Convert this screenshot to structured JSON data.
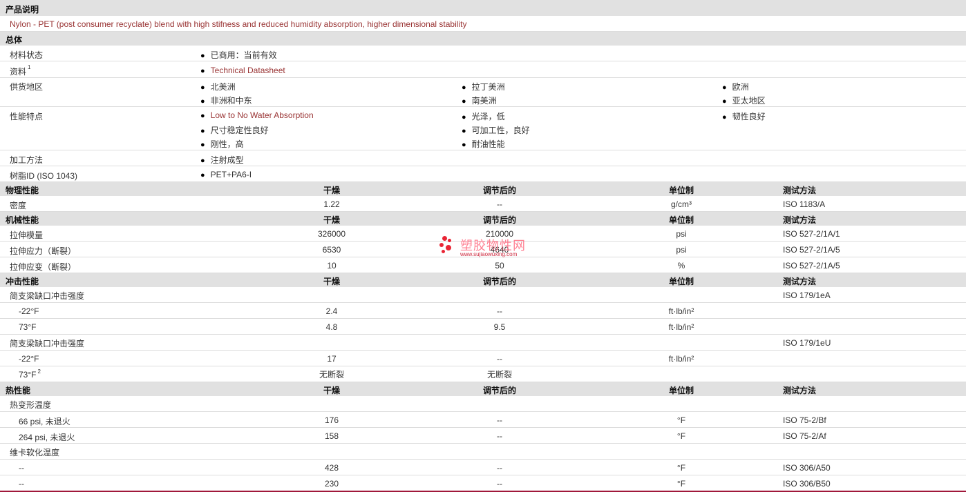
{
  "product_desc": {
    "header": "产品说明",
    "text": "Nylon - PET (post consumer recyclate) blend with high stifness and reduced humidity absorption, higher dimensional stability"
  },
  "general": {
    "header": "总体",
    "rows": {
      "status": {
        "label": "材料状态",
        "value": "已商用：当前有效"
      },
      "source": {
        "label": "资料",
        "sup": "1",
        "value": "Technical Datasheet"
      },
      "regions": {
        "label": "供货地区",
        "values": [
          "北美洲",
          "拉丁美洲",
          "欧洲",
          "非洲和中东",
          "南美洲",
          "亚太地区"
        ]
      },
      "features": {
        "label": "性能特点",
        "values": [
          "Low to No Water Absorption",
          "光泽，低",
          "韧性良好",
          "尺寸稳定性良好",
          "可加工性，良好",
          "刚性，高",
          "耐油性能"
        ]
      },
      "process": {
        "label": "加工方法",
        "value": "注射成型"
      },
      "resin_id": {
        "label": "树脂ID (ISO 1043)",
        "value": "PET+PA6-I"
      }
    }
  },
  "columns": {
    "dry": "干燥",
    "cond": "调节后的",
    "unit": "单位制",
    "method": "测试方法"
  },
  "physical": {
    "header": "物理性能",
    "rows": [
      {
        "name": "密度",
        "dry": "1.22",
        "cond": "--",
        "unit": "g/cm³",
        "method": "ISO 1183/A"
      }
    ]
  },
  "mechanical": {
    "header": "机械性能",
    "rows": [
      {
        "name": "拉伸模量",
        "dry": "326000",
        "cond": "210000",
        "unit": "psi",
        "method": "ISO 527-2/1A/1"
      },
      {
        "name": "拉伸应力（断裂）",
        "dry": "6530",
        "cond": "4640",
        "unit": "psi",
        "method": "ISO 527-2/1A/5"
      },
      {
        "name": "拉伸应变（断裂）",
        "dry": "10",
        "cond": "50",
        "unit": "%",
        "method": "ISO 527-2/1A/5"
      }
    ]
  },
  "impact": {
    "header": "冲击性能",
    "rows": [
      {
        "name": "简支梁缺口冲击强度",
        "dry": "",
        "cond": "",
        "unit": "",
        "method": "ISO 179/1eA"
      },
      {
        "name": "-22°F",
        "dry": "2.4",
        "cond": "--",
        "unit": "ft·lb/in²",
        "method": ""
      },
      {
        "name": "73°F",
        "dry": "4.8",
        "cond": "9.5",
        "unit": "ft·lb/in²",
        "method": ""
      },
      {
        "name": "简支梁缺口冲击强度",
        "dry": "",
        "cond": "",
        "unit": "",
        "method": "ISO 179/1eU"
      },
      {
        "name": "-22°F",
        "dry": "17",
        "cond": "--",
        "unit": "ft·lb/in²",
        "method": ""
      },
      {
        "name": "73°F",
        "sup": "2",
        "dry": "无断裂",
        "cond": "无断裂",
        "unit": "",
        "method": ""
      }
    ]
  },
  "thermal": {
    "header": "热性能",
    "rows": [
      {
        "name": "热变形温度",
        "dry": "",
        "cond": "",
        "unit": "",
        "method": ""
      },
      {
        "name": "66 psi, 未退火",
        "dry": "176",
        "cond": "--",
        "unit": "°F",
        "method": "ISO 75-2/Bf"
      },
      {
        "name": "264 psi, 未退火",
        "dry": "158",
        "cond": "--",
        "unit": "°F",
        "method": "ISO 75-2/Af"
      },
      {
        "name": "维卡软化温度",
        "dry": "",
        "cond": "",
        "unit": "",
        "method": ""
      },
      {
        "name": "--",
        "dry": "428",
        "cond": "--",
        "unit": "°F",
        "method": "ISO 306/A50"
      },
      {
        "name": "--",
        "dry": "230",
        "cond": "--",
        "unit": "°F",
        "method": "ISO 306/B50"
      }
    ]
  },
  "watermark": {
    "title": "塑胶物性网",
    "url": "www.sujiaowuxing.com",
    "brand_color": "#e60012"
  }
}
